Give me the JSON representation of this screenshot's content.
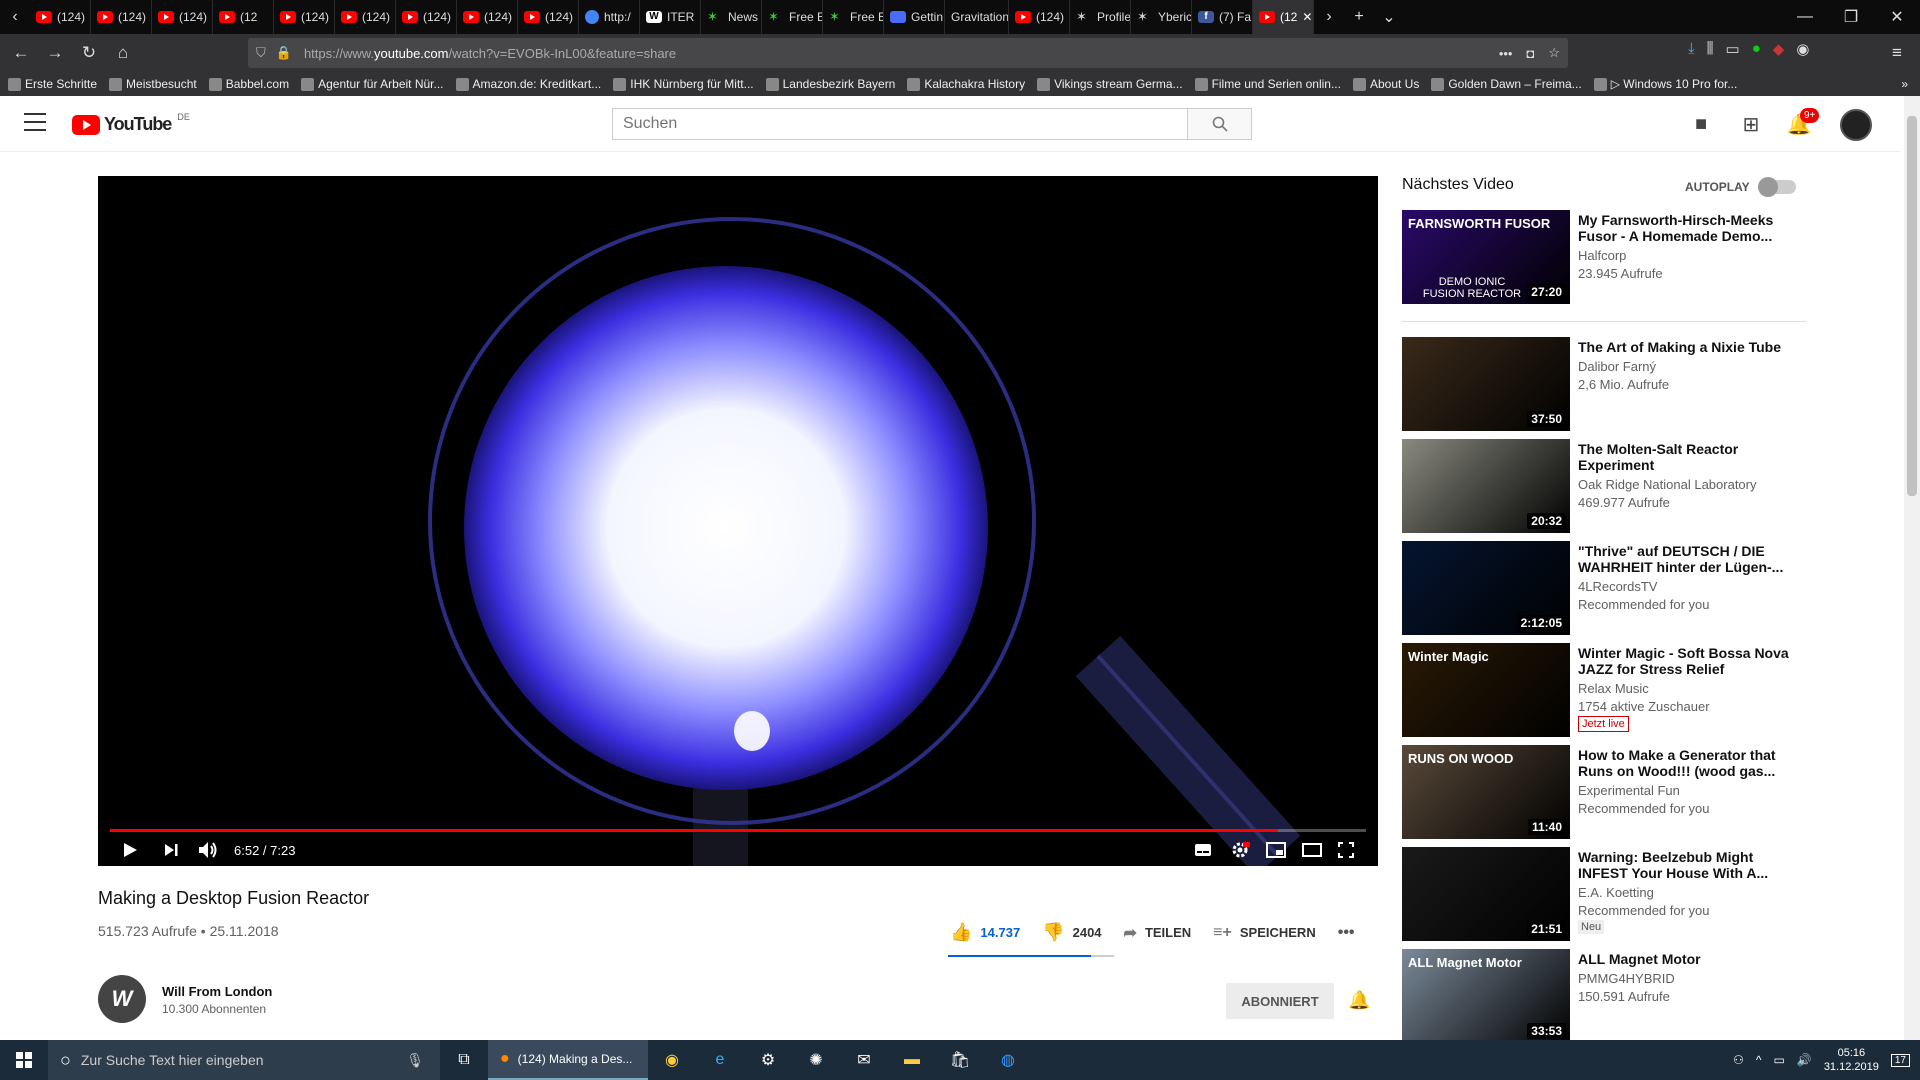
{
  "browser": {
    "tabs": [
      {
        "label": "(124)",
        "icon": "youtube-icon"
      },
      {
        "label": "(124)",
        "icon": "youtube-icon"
      },
      {
        "label": "(124)",
        "icon": "youtube-icon"
      },
      {
        "label": "(12",
        "icon": "youtube-icon"
      },
      {
        "label": "(124)",
        "icon": "youtube-icon"
      },
      {
        "label": "(124)",
        "icon": "youtube-icon"
      },
      {
        "label": "(124)",
        "icon": "youtube-icon"
      },
      {
        "label": "(124)",
        "icon": "youtube-icon"
      },
      {
        "label": "(124)",
        "icon": "youtube-icon"
      },
      {
        "label": "http:/",
        "icon": "google-icon"
      },
      {
        "label": "ITER",
        "icon": "wikipedia-icon"
      },
      {
        "label": "News",
        "icon": "star-icon"
      },
      {
        "label": "Free E",
        "icon": "star-icon"
      },
      {
        "label": "Free E",
        "icon": "star-icon"
      },
      {
        "label": "Gettin",
        "icon": "doc-icon"
      },
      {
        "label": "Gravitation",
        "icon": "none"
      },
      {
        "label": "(124)",
        "icon": "youtube-icon"
      },
      {
        "label": "Profile",
        "icon": "star-icon"
      },
      {
        "label": "Yberic",
        "icon": "star-icon"
      },
      {
        "label": "(7) Fa",
        "icon": "facebook-icon"
      },
      {
        "label": "(12",
        "icon": "youtube-icon",
        "active": true
      }
    ],
    "url_prefix": "https://www.",
    "url_domain": "youtube.com",
    "url_rest": "/watch?v=EVOBk-InL00&feature=share",
    "bookmarks": [
      "Erste Schritte",
      "Meistbesucht",
      "Babbel.com",
      "Agentur für Arbeit Nür...",
      "Amazon.de: Kreditkart...",
      "IHK Nürnberg für Mitt...",
      "Landesbezirk Bayern",
      "Kalachakra History",
      "Vikings stream Germa...",
      "Filme und Serien onlin...",
      "About Us",
      "Golden Dawn – Freima...",
      "▷ Windows 10 Pro for..."
    ]
  },
  "header": {
    "logo_text": "YouTube",
    "logo_region": "DE",
    "search_placeholder": "Suchen",
    "notif_count": "9+"
  },
  "video": {
    "time_current": "6:52",
    "time_total": "7:23",
    "progress": 0.93,
    "title": "Making a Desktop Fusion Reactor",
    "views": "515.723 Aufrufe",
    "date": "25.11.2018",
    "likes": "14.737",
    "dislikes": "2404",
    "like_ratio": 0.86,
    "share_label": "TEILEN",
    "save_label": "SPEICHERN"
  },
  "channel": {
    "name": "Will From London",
    "subs": "10.300 Abonnenten",
    "subscribe_label": "ABONNIERT"
  },
  "sidebar": {
    "heading": "Nächstes Video",
    "autoplay_label": "AUTOPLAY",
    "items": [
      {
        "title": "My Farnsworth-Hirsch-Meeks Fusor - A Homemade Demo...",
        "channel": "Halfcorp",
        "views": "23.945 Aufrufe",
        "duration": "27:20",
        "thumb_text": "FARNSWORTH FUSOR",
        "thumb_sub": "DEMO IONIC FUSION REACTOR",
        "color": "#2a0a6a"
      },
      {
        "title": "The Art of Making a Nixie Tube",
        "channel": "Dalibor Farný",
        "views": "2,6 Mio. Aufrufe",
        "duration": "37:50",
        "color": "#3a2a1a"
      },
      {
        "title": "The Molten-Salt Reactor Experiment",
        "channel": "Oak Ridge National Laboratory",
        "views": "469.977 Aufrufe",
        "duration": "20:32",
        "color": "#8a8a80"
      },
      {
        "title": "\"Thrive\" auf DEUTSCH / DIE WAHRHEIT hinter der Lügen-...",
        "channel": "4LRecordsTV",
        "views": "Recommended for you",
        "duration": "2:12:05",
        "color": "#051530"
      },
      {
        "title": "Winter Magic - Soft Bossa Nova JAZZ for Stress Relief",
        "channel": "Relax Music",
        "views": "1754 aktive Zuschauer",
        "badge": "Jetzt live",
        "badge_type": "live",
        "thumb_text": "Winter Magic",
        "color": "#2a1a05"
      },
      {
        "title": "How to Make a Generator that Runs on Wood!!! (wood gas...",
        "channel": "Experimental Fun",
        "views": "Recommended for you",
        "duration": "11:40",
        "thumb_text": "RUNS ON WOOD",
        "color": "#5a4a3a"
      },
      {
        "title": "Warning: Beelzebub Might INFEST Your House With A...",
        "channel": "E.A. Koetting",
        "views": "Recommended for you",
        "badge": "Neu",
        "badge_type": "neu",
        "duration": "21:51",
        "color": "#1a1a1a"
      },
      {
        "title": "ALL Magnet Motor",
        "channel": "PMMG4HYBRID",
        "views": "150.591 Aufrufe",
        "duration": "33:53",
        "thumb_text": "ALL Magnet Motor",
        "color": "#7a8a9a"
      }
    ]
  },
  "taskbar": {
    "search_placeholder": "Zur Suche Text hier eingeben",
    "active_app": "(124) Making a Des...",
    "time": "05:16",
    "date": "31.12.2019",
    "notif": "17"
  }
}
